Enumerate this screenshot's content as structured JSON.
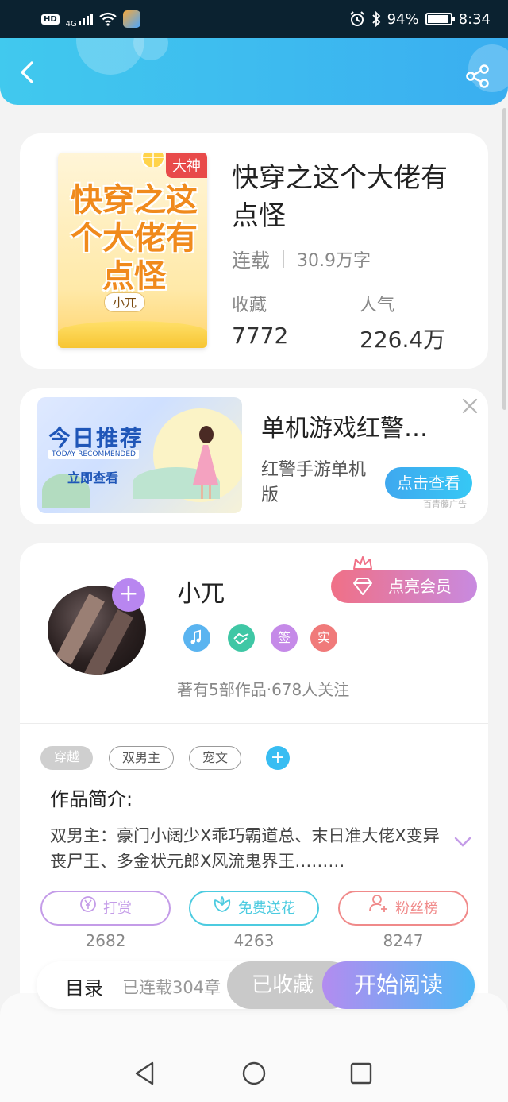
{
  "status_bar": {
    "hd": "HD",
    "network": "4G",
    "battery_percent": "94%",
    "battery_level": 0.94,
    "time": "8:34",
    "icons": [
      "signal-icon",
      "wifi-icon",
      "alarm-icon",
      "bluetooth-icon",
      "battery-icon"
    ]
  },
  "header": {
    "back_icon": "chevron-left-icon",
    "share_icon": "share-icon",
    "colors": {
      "start": "#41c9ee",
      "end": "#3aaef0"
    }
  },
  "book": {
    "cover_badge": "大神",
    "cover_title": "快穿之这个大佬有点怪",
    "cover_author": "小兀",
    "title": "快穿之这个大佬有点怪",
    "status": "连载",
    "word_count": "30.9万字",
    "favorites_label": "收藏",
    "favorites_value": "7772",
    "popularity_label": "人气",
    "popularity_value": "226.4万"
  },
  "ad": {
    "image_headline": "今日推荐",
    "image_sub": "TODAY RECOMMENDED",
    "image_cta": "立即查看",
    "title": "单机游戏红警…",
    "desc": "红警手游单机版",
    "button": "点击查看",
    "source": "百青藤广告",
    "close_icon": "close-icon"
  },
  "author": {
    "name": "小兀",
    "vip_button": "点亮会员",
    "badges": [
      {
        "icon": "music-medal-icon",
        "color": "#5ab4f0"
      },
      {
        "icon": "handshake-medal-icon",
        "color": "#3fc7a5"
      },
      {
        "label": "签",
        "color": "#c58ae8"
      },
      {
        "label": "实",
        "color": "#f07a7a"
      }
    ],
    "stats": "著有5部作品·678人关注"
  },
  "tags": [
    "穿越",
    "双男主",
    "宠文"
  ],
  "intro": {
    "label": "作品简介:",
    "text": "双男主：豪门小阔少X乖巧霸道总、末日准大佬X变异丧尸王、多金状元郎X风流鬼界王………"
  },
  "actions": [
    {
      "label": "打赏",
      "count": "2682",
      "color": "#c49ce8",
      "icon": "yen-coin-icon"
    },
    {
      "label": "免费送花",
      "count": "4263",
      "color": "#4ccbe0",
      "icon": "flower-icon"
    },
    {
      "label": "粉丝榜",
      "count": "8247",
      "color": "#f08a8a",
      "icon": "fans-icon"
    }
  ],
  "read_bar": {
    "toc": "目录",
    "serial_info": "已连载304章",
    "collected": "已收藏",
    "start_reading": "开始阅读"
  },
  "nav": {
    "back_icon": "nav-back-icon",
    "home_icon": "nav-home-icon",
    "recents_icon": "nav-recents-icon"
  }
}
